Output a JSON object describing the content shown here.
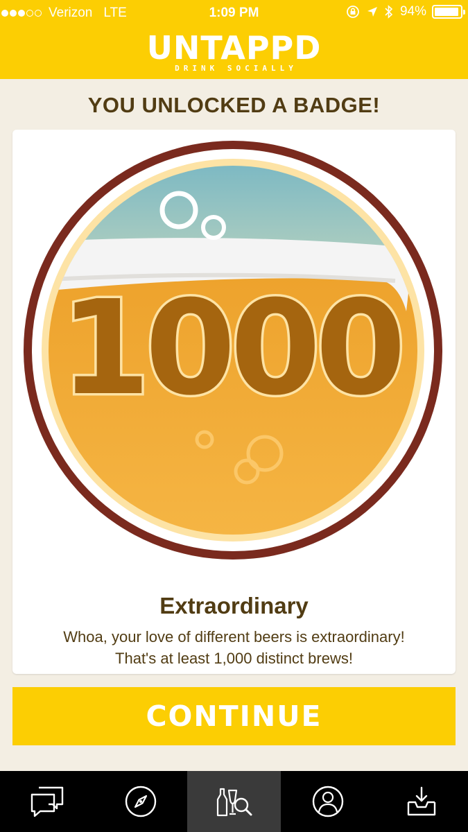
{
  "status_bar": {
    "carrier": "Verizon",
    "network": "LTE",
    "time": "1:09 PM",
    "battery": "94%",
    "battery_level": 0.94,
    "signal_bars": 3,
    "signal_total": 5
  },
  "app": {
    "title": "UNTAPPD",
    "tagline": "DRINK SOCIALLY"
  },
  "headline": "YOU UNLOCKED A BADGE!",
  "badge": {
    "number": "1000",
    "name": "Extraordinary",
    "description_line1": "Whoa, your love of different beers is extraordinary!",
    "description_line2": "That's at least 1,000 distinct brews!"
  },
  "continue_label": "CONTINUE",
  "tabs": [
    {
      "icon": "activity-feed-icon",
      "active": false
    },
    {
      "icon": "compass-icon",
      "active": false
    },
    {
      "icon": "beer-search-icon",
      "active": true
    },
    {
      "icon": "profile-icon",
      "active": false
    },
    {
      "icon": "inbox-icon",
      "active": false
    }
  ],
  "colors": {
    "brand_yellow": "#fcce03",
    "text_brown": "#513c13",
    "background": "#f3eee3",
    "badge_ring": "#7a2a1e",
    "beer_orange": "#f1a836",
    "number_brown": "#a5650f"
  }
}
